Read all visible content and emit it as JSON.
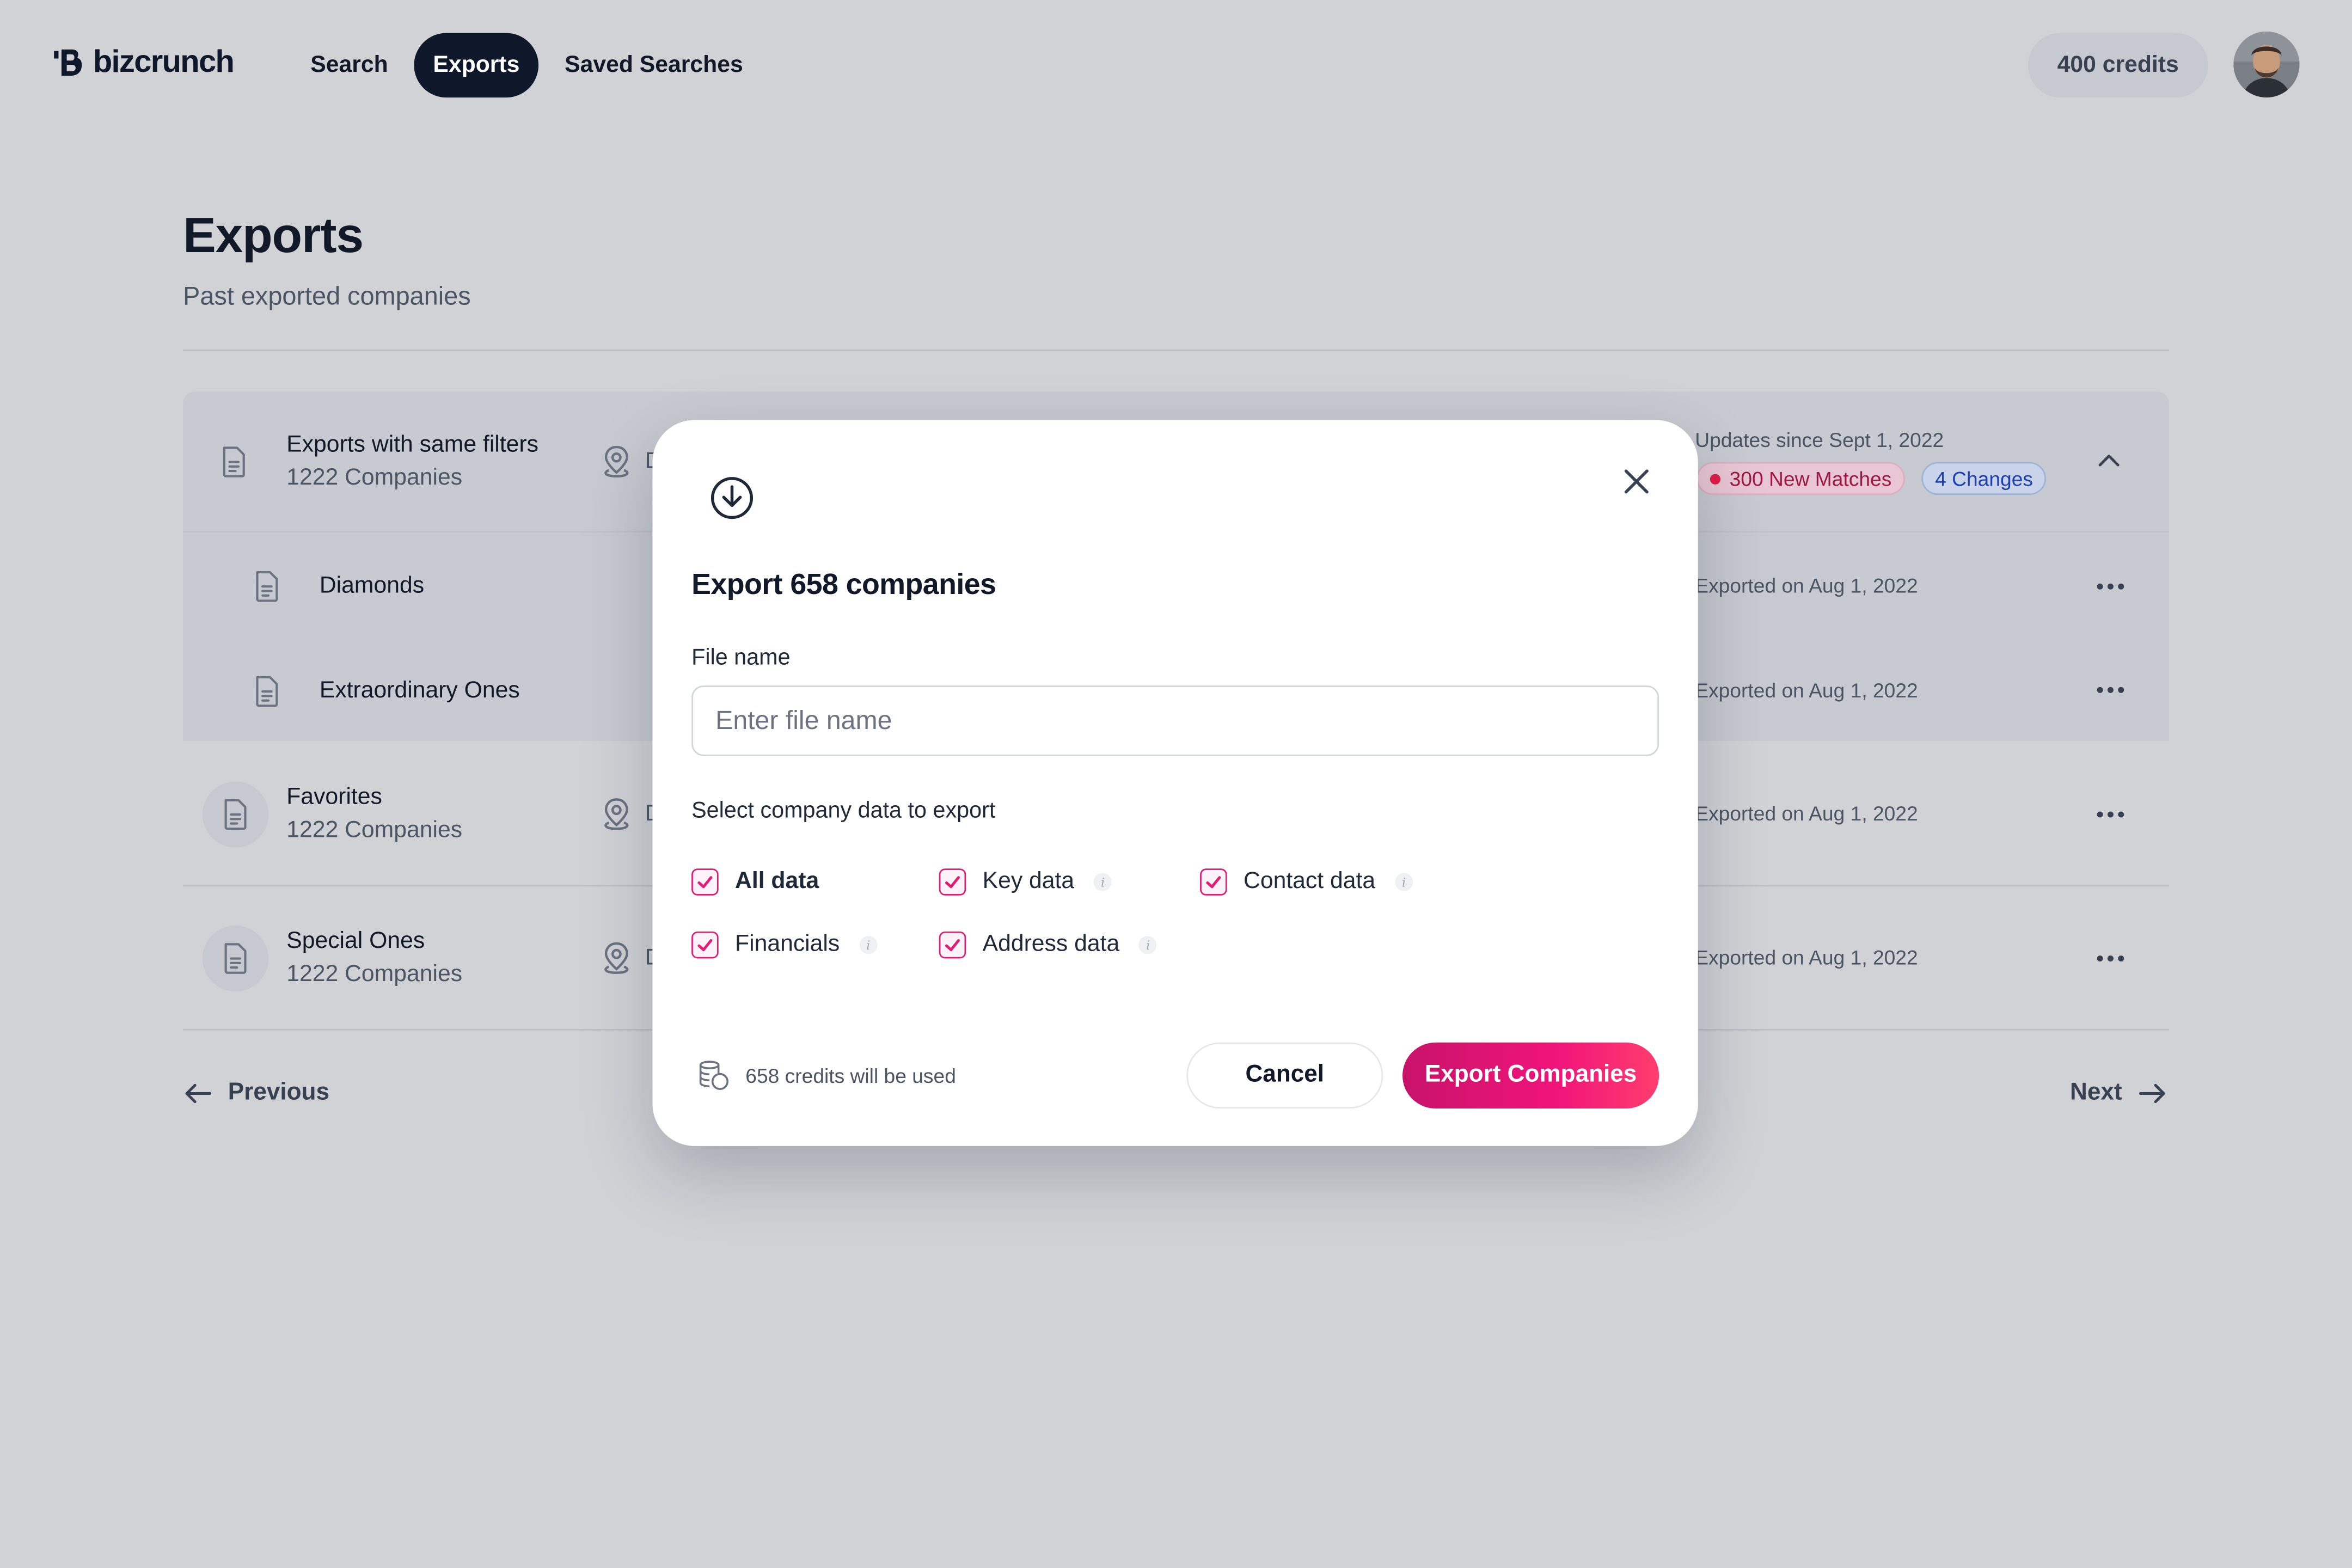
{
  "header": {
    "brand": "bizcrunch",
    "nav": [
      {
        "label": "Search",
        "active": false
      },
      {
        "label": "Exports",
        "active": true
      },
      {
        "label": "Saved Searches",
        "active": false
      }
    ],
    "credits": "400 credits"
  },
  "page": {
    "title": "Exports",
    "subtitle": "Past exported companies"
  },
  "exports": {
    "group": {
      "title": "Exports with same filters",
      "count": "1222 Companies",
      "location_truncated": "D",
      "updates": "Updates since Sept 1, 2022",
      "badge_new": "300 New Matches",
      "badge_changes": "4 Changes",
      "children": [
        {
          "title": "Diamonds",
          "date": "Exported on Aug 1, 2022"
        },
        {
          "title": "Extraordinary Ones",
          "date": "Exported on Aug 1, 2022"
        }
      ]
    },
    "rows": [
      {
        "title": "Favorites",
        "count": "1222 Companies",
        "location_truncated": "D",
        "date": "Exported on Aug 1, 2022"
      },
      {
        "title": "Special Ones",
        "count": "1222 Companies",
        "location_truncated": "D",
        "date": "Exported on Aug 1, 2022"
      }
    ]
  },
  "pagination": {
    "previous": "Previous",
    "next": "Next"
  },
  "modal": {
    "title": "Export 658 companies",
    "file_label": "File name",
    "file_placeholder": "Enter file name",
    "file_value": "",
    "select_label": "Select company data to export",
    "options": [
      {
        "label": "All data",
        "checked": true,
        "info": false
      },
      {
        "label": "Key data",
        "checked": true,
        "info": true
      },
      {
        "label": "Contact data",
        "checked": true,
        "info": true
      },
      {
        "label": "Financials",
        "checked": true,
        "info": true
      },
      {
        "label": "Address data",
        "checked": true,
        "info": true
      }
    ],
    "cost": "658 credits will be used",
    "cancel": "Cancel",
    "export": "Export Companies"
  },
  "colors": {
    "overlay_bg": "#d0d2d6",
    "brand_dark": "#0f172a",
    "accent": "#e6126f",
    "badge_red": "#9d1842",
    "badge_blue": "#1e40af"
  }
}
